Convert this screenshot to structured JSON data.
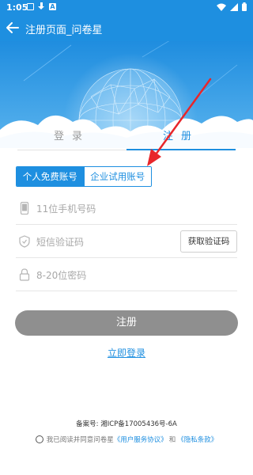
{
  "status_bar": {
    "time": "1:05"
  },
  "app_bar": {
    "title": "注册页面_问卷星"
  },
  "tabs": {
    "login": "登录",
    "register": "注册"
  },
  "account_type": {
    "personal": "个人免费账号",
    "enterprise": "企业试用账号",
    "selected": "个人免费账号"
  },
  "form": {
    "phone_placeholder": "11位手机号码",
    "code_placeholder": "短信验证码",
    "get_code_button": "获取验证码",
    "password_placeholder": "8-20位密码",
    "submit_button": "注册",
    "login_link": "立即登录"
  },
  "footer": {
    "icp": "备案号: 湘ICP备17005436号-6A",
    "agree_prefix": "我已阅读并同意问卷星",
    "user_agreement": "《用户服务协议》",
    "and": "和",
    "privacy": "《隐私条款》"
  },
  "colors": {
    "brand": "#1e8fe0",
    "button_disabled": "#8f8f8f",
    "annotation_arrow": "#e8262a"
  },
  "icons": [
    "back-arrow-icon",
    "phone-icon",
    "shield-icon",
    "lock-icon",
    "radio-icon"
  ]
}
